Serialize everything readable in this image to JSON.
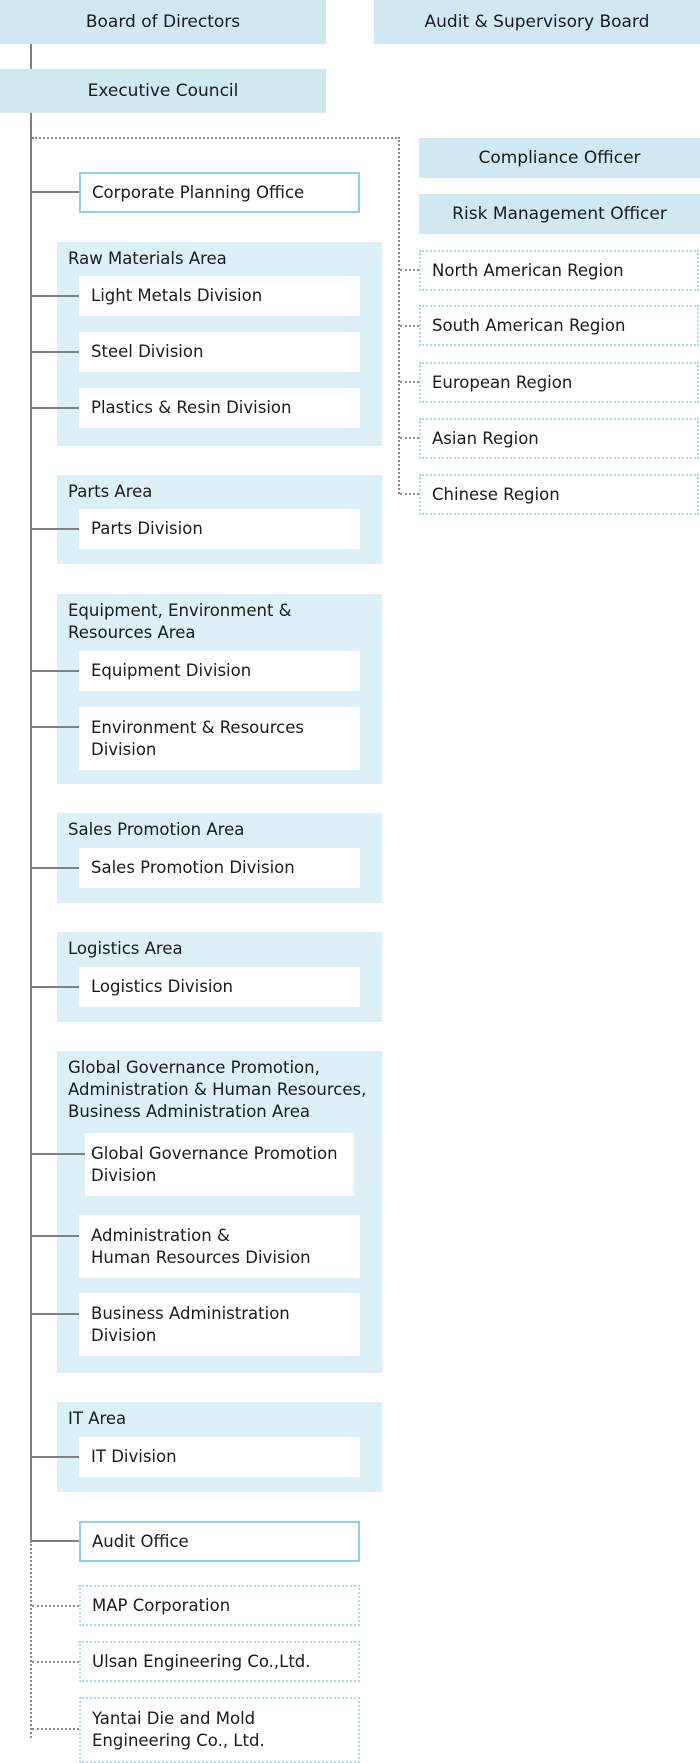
{
  "top": {
    "board_of_directors": "Board of Directors",
    "audit_supervisory_board": "Audit & Supervisory Board",
    "executive_council": "Executive Council"
  },
  "officers": {
    "compliance": "Compliance Officer",
    "risk_management": "Risk Management Officer"
  },
  "regions": [
    "North American Region",
    "South American Region",
    "European Region",
    "Asian Region",
    "Chinese Region"
  ],
  "corporate_planning": "Corporate Planning Office",
  "areas": [
    {
      "title": "Raw Materials Area",
      "divisions": [
        "Light Metals Division",
        "Steel Division",
        "Plastics & Resin Division"
      ]
    },
    {
      "title": "Parts Area",
      "divisions": [
        "Parts Division"
      ]
    },
    {
      "title": "Equipment, Environment &\nResources Area",
      "divisions": [
        "Equipment Division",
        "Environment & Resources\nDivision"
      ]
    },
    {
      "title": "Sales Promotion Area",
      "divisions": [
        "Sales Promotion Division"
      ]
    },
    {
      "title": "Logistics Area",
      "divisions": [
        "Logistics Division"
      ]
    },
    {
      "title": "Global Governance Promotion,\nAdministration & Human Resources,\nBusiness Administration Area",
      "divisions": [
        "Global Governance Promotion\nDivision",
        "Administration &\nHuman Resources Division",
        "Business Administration\nDivision"
      ]
    },
    {
      "title": "IT Area",
      "divisions": [
        "IT Division"
      ]
    }
  ],
  "audit_office": "Audit Office",
  "affiliates": [
    "MAP Corporation",
    "Ulsan Engineering Co.,Ltd.",
    "Yantai Die and Mold\nEngineering Co., Ltd."
  ],
  "colors": {
    "top_box": "#cfe9f3",
    "area_bg": "#dbf0f7",
    "solid_border": "#8fd0e8",
    "dotted_border": "#a8dbee",
    "connector": "#808080"
  }
}
